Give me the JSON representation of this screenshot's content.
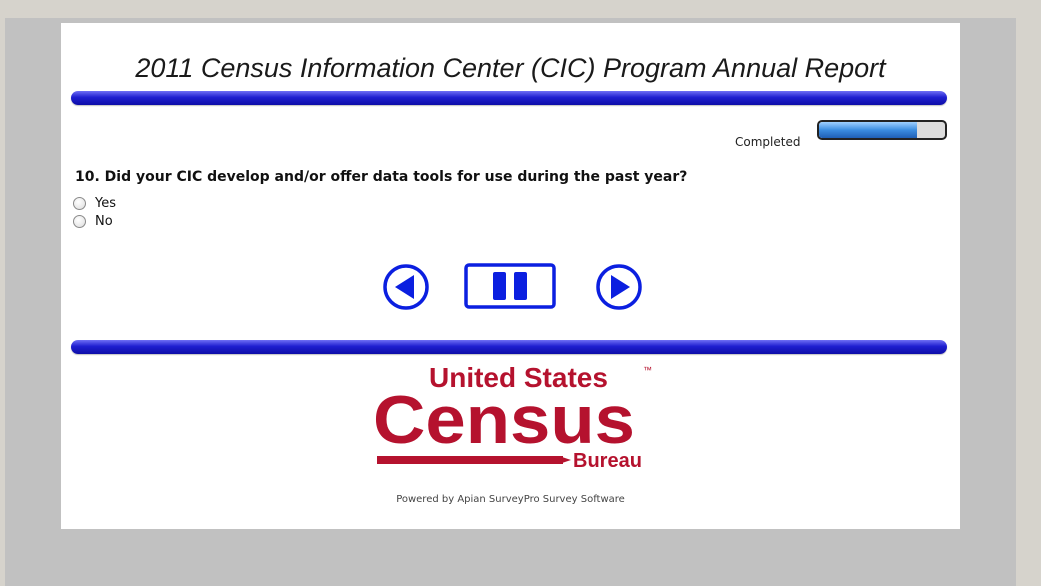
{
  "survey": {
    "title": "2011 Census Information Center (CIC) Program Annual Report",
    "progress_label": "Completed",
    "progress_fraction": 0.78
  },
  "question": {
    "text": "10. Did your CIC develop and/or offer data tools for use during the past year?",
    "options": [
      {
        "label": "Yes",
        "selected": false
      },
      {
        "label": "No",
        "selected": false
      }
    ]
  },
  "navigation": {
    "back": "back-arrow-icon",
    "pause": "pause-icon",
    "next": "next-arrow-icon"
  },
  "logo": {
    "line1": "United States",
    "trademark": "™",
    "line2": "Census",
    "line3": "Bureau"
  },
  "footer": {
    "powered_by": "Powered by Apian SurveyPro Survey Software"
  },
  "colors": {
    "accent_blue": "#0b1fe0",
    "census_red": "#b5122e"
  }
}
